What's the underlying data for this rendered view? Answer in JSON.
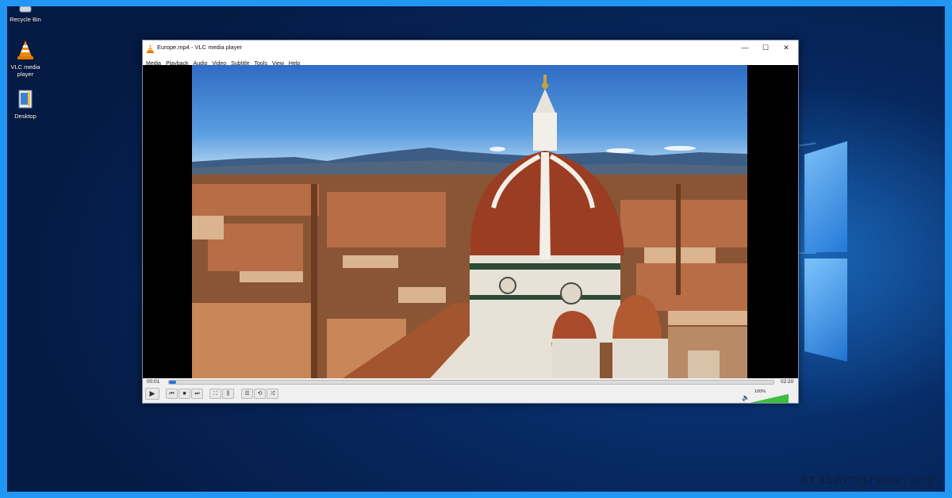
{
  "desktop": {
    "icons": [
      {
        "label": "Recycle Bin",
        "icon": "recycle-bin-icon"
      },
      {
        "label": "VLC media player",
        "icon": "vlc-cone-icon"
      },
      {
        "label": "Desktop",
        "icon": "folder-icon"
      }
    ],
    "watermark": "arabprograms.org"
  },
  "window": {
    "title": "Europe.mp4 - VLC media player",
    "buttons": {
      "minimize": "—",
      "maximize": "☐",
      "close": "✕"
    },
    "menu": [
      "Media",
      "Playback",
      "Audio",
      "Video",
      "Subtitle",
      "Tools",
      "View",
      "Help"
    ]
  },
  "player": {
    "elapsed": "00:01",
    "duration": "02:20",
    "progress_fraction": 0.012,
    "volume_label": "100%",
    "volume_fraction": 1.0,
    "controls": [
      "play-icon",
      "previous-icon",
      "stop-icon",
      "next-icon",
      "fullscreen-icon",
      "extended-settings-icon",
      "playlist-icon",
      "loop-icon",
      "shuffle-icon"
    ]
  },
  "colors": {
    "accent": "#2a73d6",
    "volume": "#3cbf3c",
    "desktop_border": "#2196f3"
  }
}
